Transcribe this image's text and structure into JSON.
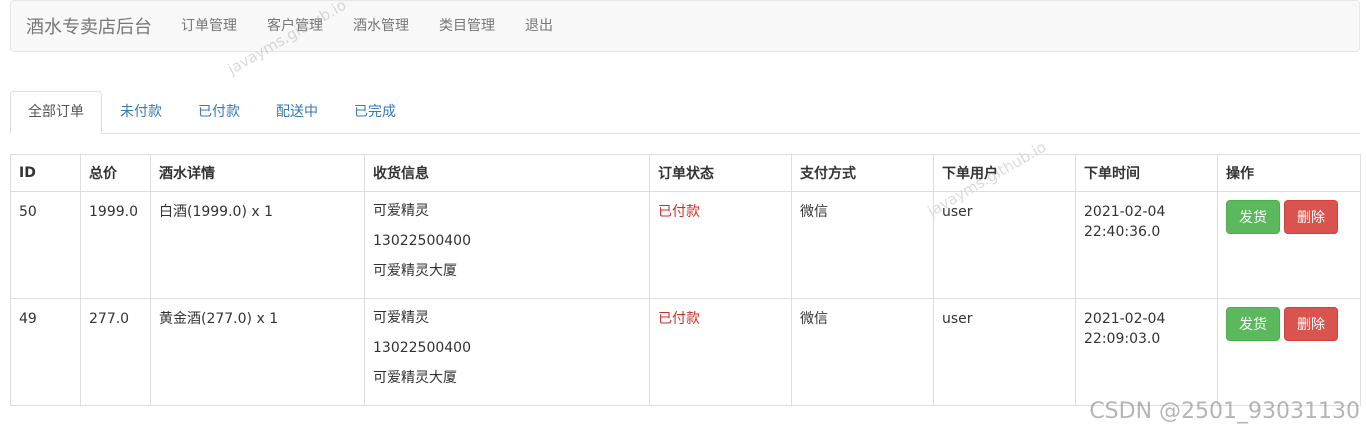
{
  "navbar": {
    "brand": "酒水专卖店后台",
    "links": [
      "订单管理",
      "客户管理",
      "酒水管理",
      "类目管理",
      "退出"
    ]
  },
  "tabs": [
    "全部订单",
    "未付款",
    "已付款",
    "配送中",
    "已完成"
  ],
  "table": {
    "headers": [
      "ID",
      "总价",
      "酒水详情",
      "收货信息",
      "订单状态",
      "支付方式",
      "下单用户",
      "下单时间",
      "操作"
    ],
    "rows": [
      {
        "id": "50",
        "total": "1999.0",
        "detail": "白酒(1999.0) x 1",
        "receiver": "可爱精灵",
        "phone": "13022500400",
        "address": "可爱精灵大厦",
        "status": "已付款",
        "payment": "微信",
        "user": "user",
        "date": "2021-02-04",
        "time": "22:40:36.0",
        "ship_label": "发货",
        "delete_label": "删除"
      },
      {
        "id": "49",
        "total": "277.0",
        "detail": "黄金酒(277.0) x 1",
        "receiver": "可爱精灵",
        "phone": "13022500400",
        "address": "可爱精灵大厦",
        "status": "已付款",
        "payment": "微信",
        "user": "user",
        "date": "2021-02-04",
        "time": "22:09:03.0",
        "ship_label": "发货",
        "delete_label": "删除"
      }
    ]
  },
  "watermark": {
    "corner": "CSDN @2501_93031130",
    "diagonal": "javayms.github.io"
  },
  "colors": {
    "link": "#337ab7",
    "status_paid": "#c9302c",
    "ship_button": "#5cb85c",
    "delete_button": "#d9534f",
    "navbar_bg": "#f8f8f8"
  }
}
